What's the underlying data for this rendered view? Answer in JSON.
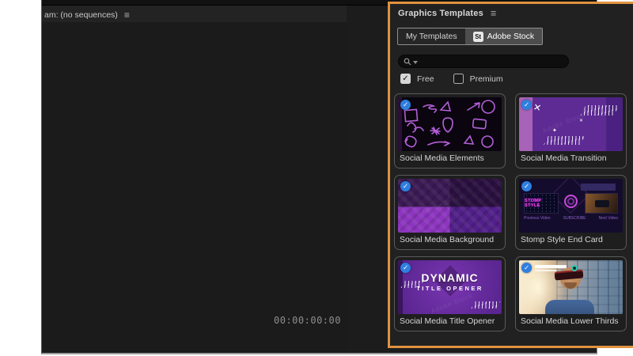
{
  "icons": {
    "menu_icon": "≡",
    "check_icon": "✓"
  },
  "program_monitor": {
    "tab_label": "am: (no sequences)",
    "timecode": "00:00:00:00"
  },
  "graphics_panel": {
    "title": "Graphics Templates",
    "accent_color": "#E0923F",
    "badge_color": "#2e7fe0",
    "tabs": {
      "my_templates": {
        "label": "My Templates",
        "selected": false
      },
      "adobe_stock": {
        "label": "Adobe Stock",
        "selected": true,
        "badge": "St"
      }
    },
    "search_placeholder": "",
    "filters": {
      "free": {
        "label": "Free",
        "checked": true
      },
      "premium": {
        "label": "Premium",
        "checked": false
      }
    },
    "watermark": "Adobe Stock",
    "templates": [
      {
        "name": "Social Media Elements",
        "selected": true
      },
      {
        "name": "Social Media Transition",
        "selected": true
      },
      {
        "name": "Social Media Background",
        "selected": true
      },
      {
        "name": "Stomp Style End Card",
        "selected": true,
        "thumb_title": "STOMP STYLE",
        "captions": {
          "left": "Previous Video",
          "center": "SUBSCRIBE",
          "right": "Next Video"
        }
      },
      {
        "name": "Social Media Title Opener",
        "selected": true,
        "title_line1": "DYNAMIC",
        "title_line2": "TITLE OPENER"
      },
      {
        "name": "Social Media Lower Thirds",
        "selected": true
      }
    ]
  }
}
